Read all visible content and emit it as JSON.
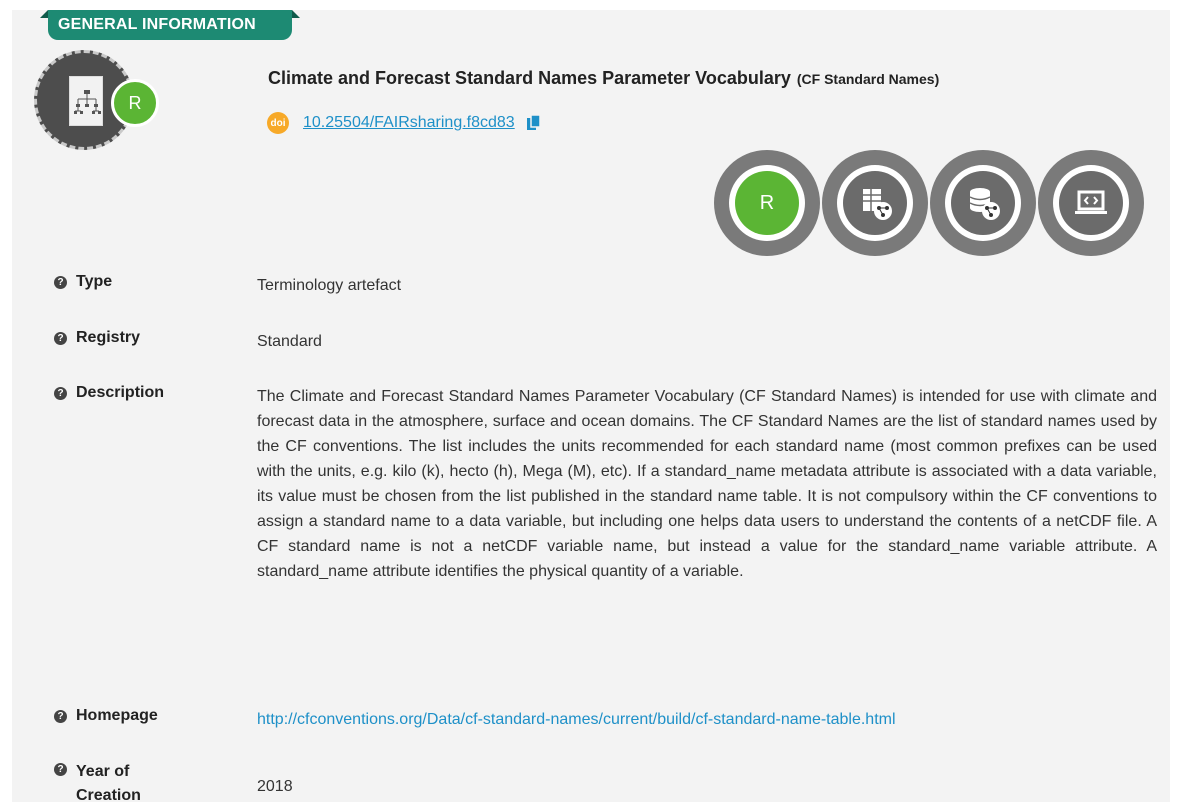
{
  "section": {
    "tab_label": "GENERAL INFORMATION"
  },
  "record": {
    "logo_badge": "R",
    "title": "Climate and Forecast Standard Names Parameter Vocabulary",
    "abbreviation": "(CF Standard Names)",
    "doi_icon": "doi",
    "doi": "10.25504/FAIRsharing.f8cd83",
    "copy_icon": "copy-icon"
  },
  "badges": [
    {
      "name": "registry-badge",
      "label": "R"
    },
    {
      "name": "standard-badge",
      "icon": "table-network-icon"
    },
    {
      "name": "database-badge",
      "icon": "database-network-icon"
    },
    {
      "name": "policy-badge",
      "icon": "laptop-code-icon"
    }
  ],
  "fields": {
    "type": {
      "label": "Type",
      "value": "Terminology artefact"
    },
    "registry": {
      "label": "Registry",
      "value": "Standard"
    },
    "description": {
      "label": "Description",
      "value": "The Climate and Forecast Standard Names Parameter Vocabulary (CF Standard Names) is intended for use with climate and forecast data in the atmosphere, surface and ocean domains. The CF Standard Names are the list of standard names used by the CF conventions. The list includes the units recommended for each standard name (most common prefixes can be used with the units, e.g. kilo (k), hecto (h), Mega (M), etc). If a standard_name metadata attribute is associated with a data variable, its value must be chosen from the list published in the standard name table. It is not compulsory within the CF conventions to assign a standard name to a data variable, but including one helps data users to understand the contents of a netCDF file. A CF standard name is not a netCDF variable name, but instead a value for the standard_name variable attribute. A standard_name attribute identifies the physical quantity of a variable."
    },
    "homepage": {
      "label": "Homepage",
      "value": "http://cfconventions.org/Data/cf-standard-names/current/build/cf-standard-name-table.html"
    },
    "year": {
      "label": "Year of Creation",
      "value": "2018"
    }
  },
  "help_icon": "?"
}
